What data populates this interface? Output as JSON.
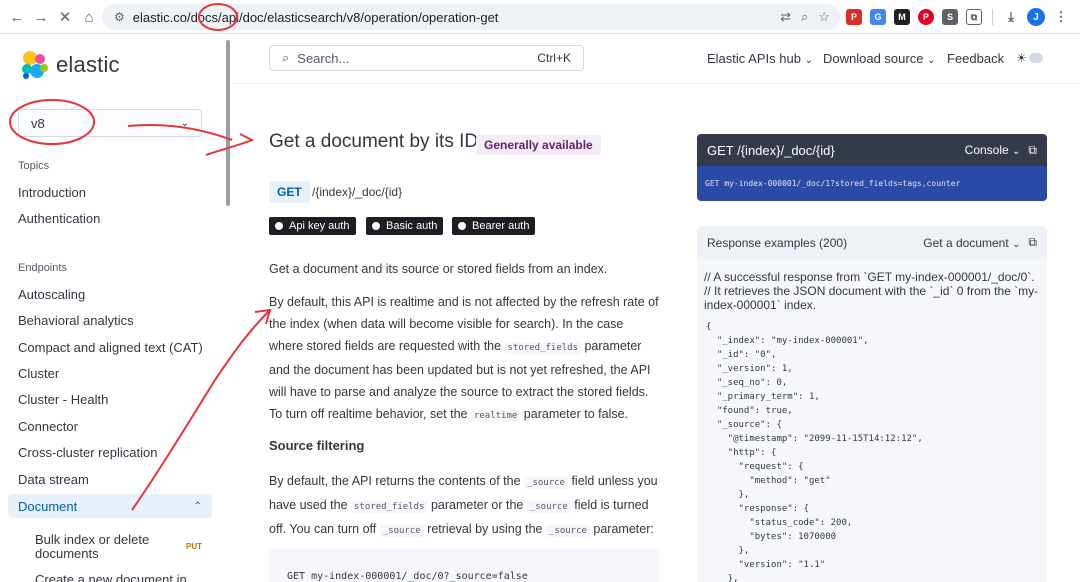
{
  "browser": {
    "url": "elastic.co/docs/api/doc/elasticsearch/v8/operation/operation-get",
    "avatar_letter": "J"
  },
  "sidebar": {
    "logo_text": "elastic",
    "version": "v8",
    "topics_heading": "Topics",
    "topics": [
      "Introduction",
      "Authentication"
    ],
    "endpoints_heading": "Endpoints",
    "endpoints": [
      "Autoscaling",
      "Behavioral analytics",
      "Compact and aligned text (CAT)",
      "Cluster",
      "Cluster - Health",
      "Connector",
      "Cross-cluster replication",
      "Data stream"
    ],
    "active_item": "Document",
    "sub_items": [
      {
        "label": "Bulk index or delete documents",
        "method": "PUT"
      },
      {
        "label": "Create a new document in",
        "method": ""
      }
    ]
  },
  "header": {
    "search_placeholder": "Search...",
    "search_shortcut": "Ctrl+K",
    "links": [
      "Elastic APIs hub",
      "Download source",
      "Feedback"
    ]
  },
  "main": {
    "title": "Get a document by its ID",
    "status_badge": "Generally available",
    "method": "GET",
    "endpoint": "/{index}/_doc/{id}",
    "auth": [
      "Api key auth",
      "Basic auth",
      "Bearer auth"
    ],
    "intro": "Get a document and its source or stored fields from an index.",
    "para1_a": "By default, this API is realtime and is not affected by the refresh rate of the index (when data will become visible for search). In the case where stored fields are requested with the ",
    "para1_code1": "stored_fields",
    "para1_b": " parameter and the document has been updated but is not yet refreshed, the API will have to parse and analyze the source to extract the stored fields. To turn off realtime behavior, set the ",
    "para1_code2": "realtime",
    "para1_c": " parameter to false.",
    "subheading": "Source filtering",
    "para2_a": "By default, the API returns the contents of the ",
    "para2_code1": "_source",
    "para2_b": " field unless you have used the ",
    "para2_code2": "stored_fields",
    "para2_c": " parameter or the ",
    "para2_code3": "_source",
    "para2_d": " field is turned off. You can turn off ",
    "para2_code4": "_source",
    "para2_e": " retrieval by using the ",
    "para2_code5": "_source",
    "para2_f": " parameter:",
    "code_example": "GET my-index-000001/_doc/0?_source=false"
  },
  "console": {
    "title": "GET /{index}/_doc/{id}",
    "dropdown": "Console",
    "request": "GET my-index-000001/_doc/1?stored_fields=tags,counter"
  },
  "response": {
    "title": "Response examples (200)",
    "dropdown": "Get a document",
    "comment": "// A successful response from `GET my-index-000001/_doc/0`. // It retrieves the JSON document with the `_id` 0 from the `my-index-000001` index.",
    "lines": [
      "{",
      "  \"_index\": \"my-index-000001\",",
      "  \"_id\": \"0\",",
      "  \"_version\": 1,",
      "  \"_seq_no\": 0,",
      "  \"_primary_term\": 1,",
      "  \"found\": true,",
      "  \"_source\": {",
      "    \"@timestamp\": \"2099-11-15T14:12:12\",",
      "    \"http\": {",
      "      \"request\": {",
      "        \"method\": \"get\"",
      "      },",
      "      \"response\": {",
      "        \"status_code\": 200,",
      "        \"bytes\": 1070000",
      "      },",
      "      \"version\": \"1.1\"",
      "    },"
    ]
  },
  "colors": {
    "accent": "#0061a6",
    "annotation": "#e8343a",
    "badge_bg": "#f4ecf7"
  }
}
